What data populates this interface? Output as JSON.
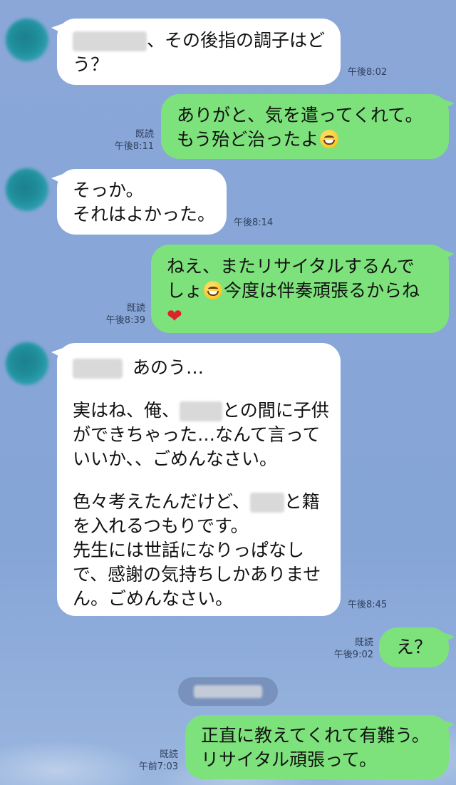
{
  "messages": [
    {
      "id": "m1",
      "direction": "incoming",
      "lines": [
        "、その後指の調子はど",
        "う？"
      ],
      "time": "午後8:02"
    },
    {
      "id": "m2",
      "direction": "outgoing",
      "lines": [
        "ありがと、気を遣ってくれて。",
        "もう殆ど治ったよ"
      ],
      "emoji": "grinning-face",
      "read_label": "既読",
      "time": "午後8:11"
    },
    {
      "id": "m3",
      "direction": "incoming",
      "lines": [
        "そっか。",
        "それはよかった。"
      ],
      "time": "午後8:14"
    },
    {
      "id": "m4",
      "direction": "outgoing",
      "lines": [
        "ねえ、またリサイタルするんで",
        "しょ",
        "今度は伴奏頑張るからね"
      ],
      "emojis": [
        "grinning-face",
        "red-heart"
      ],
      "read_label": "既読",
      "time": "午後8:39"
    },
    {
      "id": "m5",
      "direction": "incoming",
      "p1": "あのう…",
      "p2": [
        "実はね、俺、",
        "との間に子供",
        "ができちゃった…なんて言って",
        "いいか、、ごめんなさい。"
      ],
      "p3": [
        "色々考えたんだけど、",
        "と籍",
        "を入れるつもりです。",
        "先生には世話になりっぱなし",
        "で、感謝の気持ちしかありませ",
        "ん。ごめんなさい。"
      ],
      "time": "午後8:45"
    },
    {
      "id": "m6",
      "direction": "outgoing",
      "lines": [
        "え？"
      ],
      "read_label": "既読",
      "time": "午後9:02"
    },
    {
      "id": "m7",
      "direction": "outgoing",
      "lines": [
        "正直に教えてくれて有難う。",
        "リサイタル頑張って。"
      ],
      "read_label": "既読",
      "time": "午前7:03"
    }
  ],
  "colors": {
    "background": "#8aa7d8",
    "incoming_bubble": "#ffffff",
    "outgoing_bubble": "#7de27b",
    "meta_text": "#2f3f5c"
  }
}
